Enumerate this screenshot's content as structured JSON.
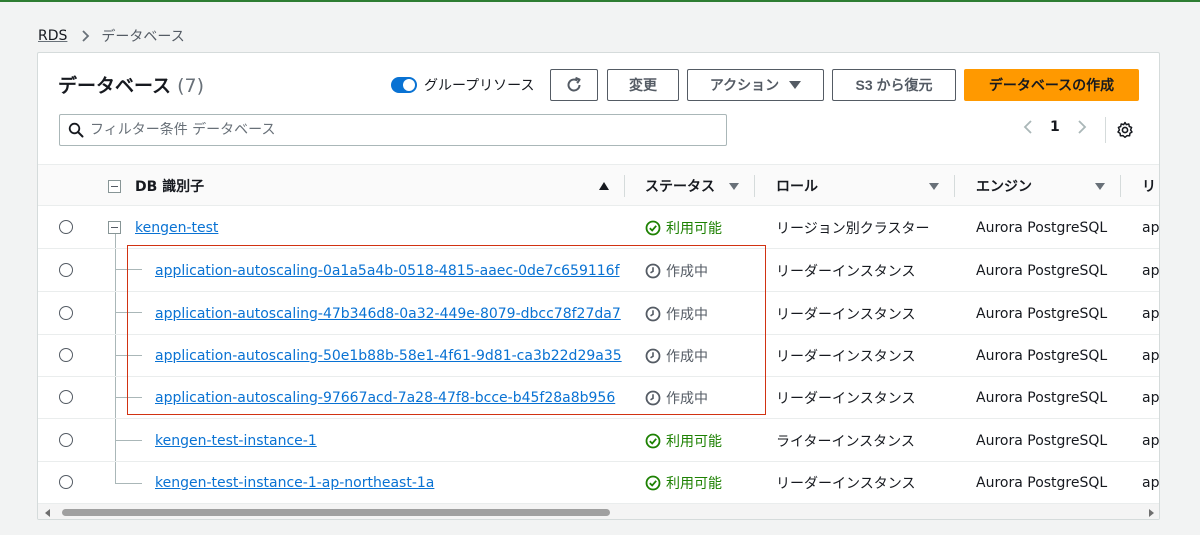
{
  "breadcrumb": {
    "root": "RDS",
    "current": "データベース"
  },
  "panel": {
    "title": "データベース",
    "count": "(7)",
    "group_toggle_label": "グループリソース",
    "group_toggle_on": true
  },
  "toolbar": {
    "modify_label": "変更",
    "actions_label": "アクション",
    "restore_s3_label": "S3 から復元",
    "create_label": "データベースの作成"
  },
  "search": {
    "placeholder": "フィルター条件 データベース",
    "value": ""
  },
  "pager": {
    "page": "1"
  },
  "columns": {
    "identifier": "DB 識別子",
    "status": "ステータス",
    "role": "ロール",
    "engine": "エンジン",
    "region_partial": "リ"
  },
  "rows": [
    {
      "id": "kengen-test",
      "status": "利用可能",
      "status_type": "available",
      "role": "リージョン別クラスター",
      "engine": "Aurora PostgreSQL",
      "region": "ap-"
    },
    {
      "id": "application-autoscaling-0a1a5a4b-0518-4815-aaec-0de7c659116f",
      "status": "作成中",
      "status_type": "creating",
      "role": "リーダーインスタンス",
      "engine": "Aurora PostgreSQL",
      "region": "ap-"
    },
    {
      "id": "application-autoscaling-47b346d8-0a32-449e-8079-dbcc78f27da7",
      "status": "作成中",
      "status_type": "creating",
      "role": "リーダーインスタンス",
      "engine": "Aurora PostgreSQL",
      "region": "ap-"
    },
    {
      "id": "application-autoscaling-50e1b88b-58e1-4f61-9d81-ca3b22d29a35",
      "status": "作成中",
      "status_type": "creating",
      "role": "リーダーインスタンス",
      "engine": "Aurora PostgreSQL",
      "region": "ap-"
    },
    {
      "id": "application-autoscaling-97667acd-7a28-47f8-bcce-b45f28a8b956",
      "status": "作成中",
      "status_type": "creating",
      "role": "リーダーインスタンス",
      "engine": "Aurora PostgreSQL",
      "region": "ap-"
    },
    {
      "id": "kengen-test-instance-1",
      "status": "利用可能",
      "status_type": "available",
      "role": "ライターインスタンス",
      "engine": "Aurora PostgreSQL",
      "region": "ap-"
    },
    {
      "id": "kengen-test-instance-1-ap-northeast-1a",
      "status": "利用可能",
      "status_type": "available",
      "role": "リーダーインスタンス",
      "engine": "Aurora PostgreSQL",
      "region": "ap-"
    }
  ],
  "colors": {
    "accent": "#0972d3",
    "primary_button": "#ff9900",
    "status_available": "#1d8102",
    "highlight_box": "#d13212"
  }
}
